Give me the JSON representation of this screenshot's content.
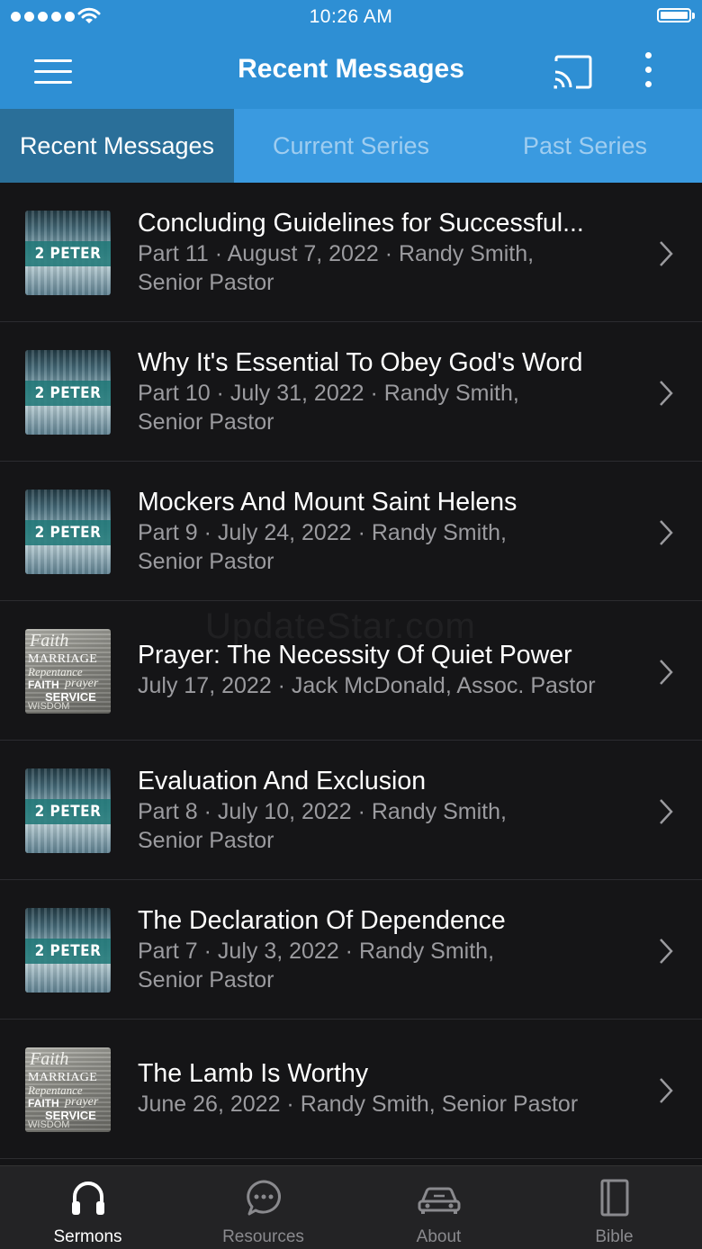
{
  "status_bar": {
    "time": "10:26 AM"
  },
  "nav": {
    "title": "Recent Messages"
  },
  "tabs": [
    {
      "label": "Recent Messages",
      "active": true
    },
    {
      "label": "Current Series",
      "active": false
    },
    {
      "label": "Past Series",
      "active": false
    }
  ],
  "thumbnails": {
    "peter": "2 PETER",
    "faith": [
      "Faith",
      "MARRIAGE",
      "Repentance",
      "FAITH",
      "prayer",
      "SERVICE",
      "WISDOM"
    ]
  },
  "messages": [
    {
      "title": "Concluding Guidelines for Successful...",
      "line1": "Part 11 · August 7, 2022 · Randy Smith,",
      "line2": "Senior Pastor",
      "art": "peter"
    },
    {
      "title": "Why It's Essential To Obey God's Word",
      "line1": "Part 10 · July 31, 2022 · Randy Smith,",
      "line2": "Senior Pastor",
      "art": "peter"
    },
    {
      "title": "Mockers And Mount Saint Helens",
      "line1": "Part 9 · July 24, 2022 · Randy Smith,",
      "line2": "Senior Pastor",
      "art": "peter"
    },
    {
      "title": "Prayer: The Necessity Of Quiet Power",
      "line1": "July 17, 2022 · Jack McDonald, Assoc. Pastor",
      "line2": "",
      "art": "faith"
    },
    {
      "title": "Evaluation And Exclusion",
      "line1": "Part 8 · July 10, 2022 · Randy Smith,",
      "line2": "Senior Pastor",
      "art": "peter"
    },
    {
      "title": "The Declaration Of Dependence",
      "line1": "Part 7 · July 3, 2022 · Randy Smith,",
      "line2": "Senior Pastor",
      "art": "peter"
    },
    {
      "title": "The Lamb Is Worthy",
      "line1": "June 26, 2022 · Randy Smith, Senior Pastor",
      "line2": "",
      "art": "faith"
    }
  ],
  "watermark": "UpdateStar.com",
  "bottom_tabs": [
    {
      "label": "Sermons",
      "icon": "headphones-icon",
      "active": true
    },
    {
      "label": "Resources",
      "icon": "chat-bubble-icon",
      "active": false
    },
    {
      "label": "About",
      "icon": "car-icon",
      "active": false
    },
    {
      "label": "Bible",
      "icon": "book-icon",
      "active": false
    }
  ],
  "colors": {
    "nav_blue": "#2e8fd4",
    "tab_active": "#2a6f99",
    "background": "#151517"
  }
}
